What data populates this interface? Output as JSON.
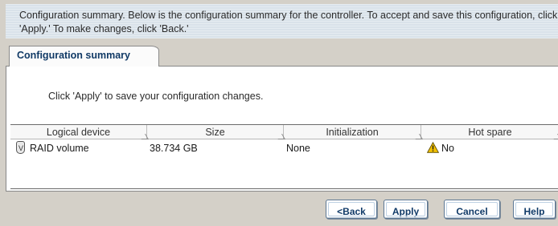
{
  "header": {
    "text": "Configuration summary. Below is the configuration summary for the controller.  To accept and save this configuration, click 'Apply.'  To make changes, click 'Back.'"
  },
  "tab": {
    "label": "Configuration summary"
  },
  "message": "Click 'Apply' to save your configuration changes.",
  "table": {
    "columns": [
      "Logical device",
      "Size",
      "Initialization",
      "Hot spare"
    ],
    "rows": [
      {
        "icon": "disk-volume-icon",
        "icon_letter": "V",
        "logical_device": "RAID volume",
        "size": "38.734 GB",
        "initialization": "None",
        "hot_spare_icon": "warning-icon",
        "hot_spare": "No"
      }
    ]
  },
  "buttons": {
    "back": "<Back",
    "apply": "Apply",
    "cancel": "Cancel",
    "help": "Help"
  },
  "colors": {
    "header_bg": "#d9e2ea",
    "tab_text": "#113a66",
    "button_border": "#5d7894",
    "warning": "#f2c000"
  }
}
